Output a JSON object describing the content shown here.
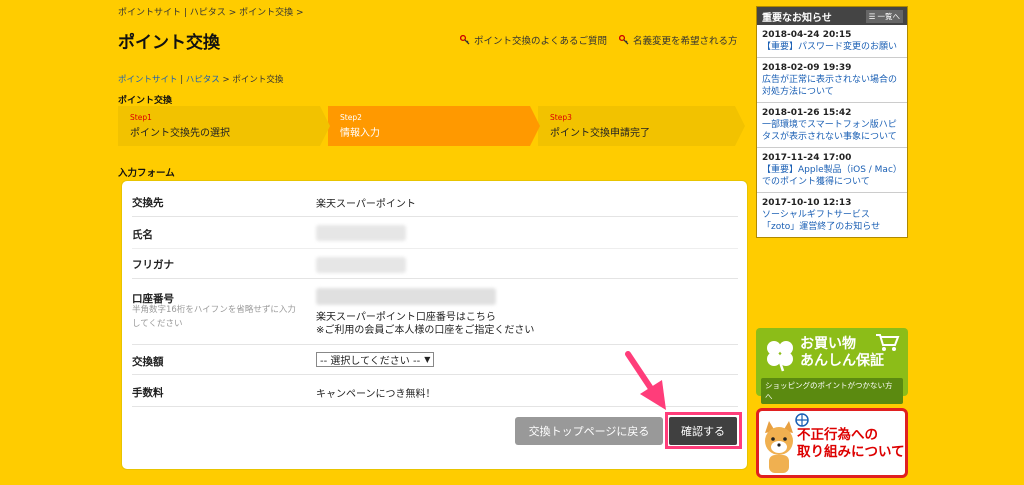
{
  "breadcrumb_top": [
    "ポイントサイト",
    "ハピタス",
    "ポイント交換",
    ">"
  ],
  "page_title": "ポイント交換",
  "header_links": [
    {
      "label": "ポイント交換のよくあるご質問",
      "icon": "key-icon"
    },
    {
      "label": "名義変更を希望される方",
      "icon": "key-icon"
    }
  ],
  "breadcrumb_second": [
    "ポイントサイト",
    "ハピタス",
    "ポイント交換"
  ],
  "section_label": "ポイント交換",
  "steps": [
    {
      "num": "Step1",
      "label": "ポイント交換先の選択"
    },
    {
      "num": "Step2",
      "label": "情報入力"
    },
    {
      "num": "Step3",
      "label": "ポイント交換申請完了"
    }
  ],
  "form_label": "入力フォーム",
  "form": {
    "destination_label": "交換先",
    "destination_value": "楽天スーパーポイント",
    "name_label": "氏名",
    "furigana_label": "フリガナ",
    "account_label": "口座番号",
    "account_hint": "半角数字16桁をハイフンを省略せずに入力してください",
    "account_link": "楽天スーパーポイント口座番号はこちら",
    "account_note": "※ご利用の会員ご本人様の口座をご指定ください",
    "amount_label": "交換額",
    "amount_select": "-- 選択してください --",
    "fee_label": "手数料",
    "fee_value": "キャンペーンにつき無料！"
  },
  "buttons": {
    "back": "交換トップページに戻る",
    "confirm": "確認する"
  },
  "sidebar": {
    "title": "重要なお知らせ",
    "list_label": "一覧へ",
    "news": [
      {
        "date": "2018-04-24 20:15",
        "title": "【重要】パスワード変更のお願い"
      },
      {
        "date": "2018-02-09 19:39",
        "title": "広告が正常に表示されない場合の対処方法について"
      },
      {
        "date": "2018-01-26 15:42",
        "title": "一部環境でスマートフォン版ハピタスが表示されない事象について"
      },
      {
        "date": "2017-11-24 17:00",
        "title": "【重要】Apple製品（iOS / Mac）でのポイント獲得について"
      },
      {
        "date": "2017-10-10 12:13",
        "title": "ソーシャルギフトサービス「zoto」運営終了のお知らせ"
      }
    ]
  },
  "banner_shopping": {
    "title_line1": "お買い物",
    "title_line2": "あんしん保証",
    "sub": "ショッピングのポイントがつかない方へ"
  },
  "banner_fraud": {
    "line1": "不正行為への",
    "line2": "取り組みについて"
  },
  "colors": {
    "background": "#ffcc00",
    "step_active": "#ff9900",
    "highlight": "#ff3d7a",
    "link": "#1a5fb4"
  }
}
